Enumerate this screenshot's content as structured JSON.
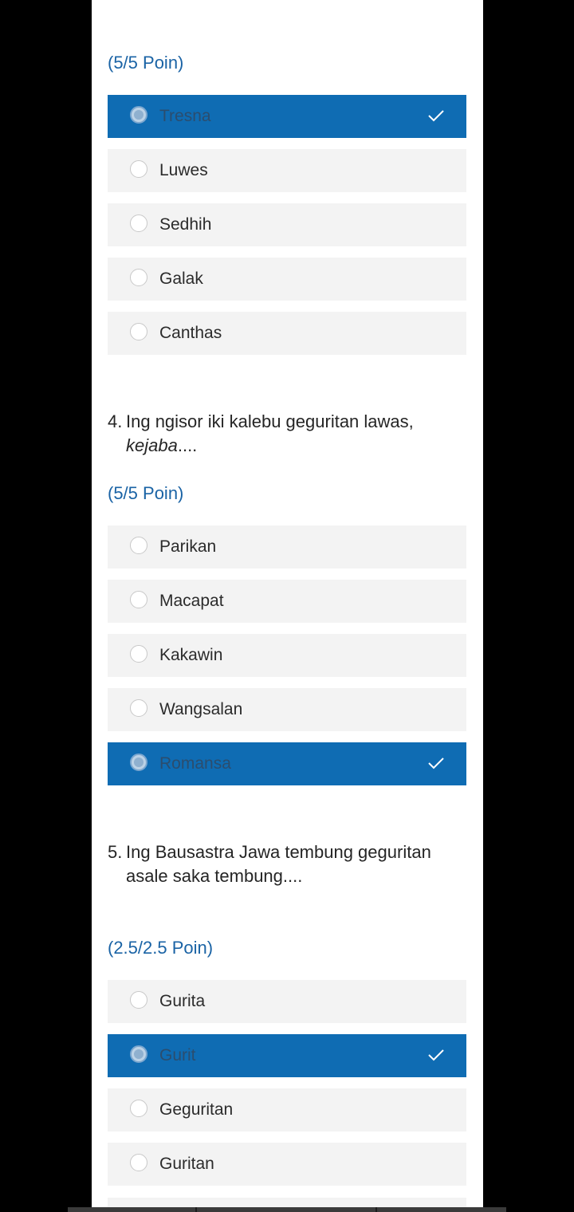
{
  "questions": [
    {
      "points": "(5/5 Poin)",
      "options": [
        {
          "label": "Tresna",
          "selected": true
        },
        {
          "label": "Luwes",
          "selected": false
        },
        {
          "label": "Sedhih",
          "selected": false
        },
        {
          "label": "Galak",
          "selected": false
        },
        {
          "label": "Canthas",
          "selected": false
        }
      ]
    },
    {
      "number": "4.",
      "text_main": "Ing ngisor iki kalebu geguritan lawas,",
      "text_emphasis": "kejaba",
      "text_tail": "....",
      "points": "(5/5 Poin)",
      "options": [
        {
          "label": "Parikan",
          "selected": false
        },
        {
          "label": "Macapat",
          "selected": false
        },
        {
          "label": "Kakawin",
          "selected": false
        },
        {
          "label": "Wangsalan",
          "selected": false
        },
        {
          "label": "Romansa",
          "selected": true
        }
      ]
    },
    {
      "number": "5.",
      "text_line1": "Ing Bausastra Jawa tembung geguritan",
      "text_line2": "asale saka tembung....",
      "points": "(2.5/2.5 Poin)",
      "options": [
        {
          "label": "Gurita",
          "selected": false
        },
        {
          "label": "Gurit",
          "selected": true
        },
        {
          "label": "Geguritan",
          "selected": false
        },
        {
          "label": "Guritan",
          "selected": false
        }
      ]
    }
  ],
  "colors": {
    "selected_bg": "#0f6cb3",
    "option_bg": "#f3f3f3",
    "points_text": "#1a63a5",
    "page_bg": "#000000",
    "card_bg": "#ffffff"
  },
  "icons": {
    "check": "check-icon",
    "radio": "radio-icon"
  }
}
